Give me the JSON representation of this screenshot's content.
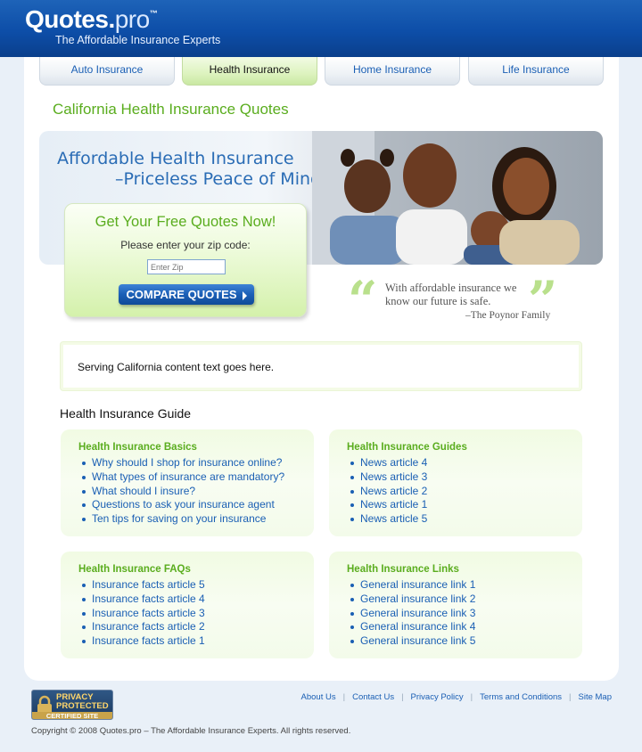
{
  "brand": {
    "name": "Quotes.",
    "suffix": "pro",
    "tm": "™",
    "tagline": "The Affordable Insurance Experts"
  },
  "nav": {
    "tabs": [
      {
        "label": "Auto Insurance"
      },
      {
        "label": "Health Insurance",
        "active": true
      },
      {
        "label": "Home Insurance"
      },
      {
        "label": "Life Insurance"
      }
    ]
  },
  "page_title": "California Health Insurance Quotes",
  "hero": {
    "line1": "Affordable Health Insurance",
    "line2": "–Priceless Peace of Mind."
  },
  "quote_form": {
    "heading": "Get Your Free Quotes Now!",
    "prompt": "Please enter your zip code:",
    "zip_placeholder": "Enter Zip",
    "button_label": "COMPARE QUOTES"
  },
  "testimonial": {
    "line1": "With affordable insurance we",
    "line2": "know our future is safe.",
    "attribution": "–The Poynor Family"
  },
  "serving_text": "Serving California content text goes here.",
  "guide": {
    "title": "Health Insurance Guide",
    "sections": [
      {
        "heading": "Health Insurance Basics",
        "items": [
          "Why should I shop for insurance online?",
          "What types of insurance are mandatory?",
          "What should I insure?",
          "Questions to ask your insurance agent",
          "Ten tips for saving on your insurance"
        ]
      },
      {
        "heading": "Health Insurance Guides",
        "items": [
          "News article 4",
          "News article 3",
          "News article 2",
          "News article 1",
          "News article 5"
        ]
      },
      {
        "heading": "Health Insurance FAQs",
        "items": [
          "Insurance facts article 5",
          "Insurance facts article 4",
          "Insurance facts article 3",
          "Insurance facts article 2",
          "Insurance facts article 1"
        ]
      },
      {
        "heading": "Health Insurance Links",
        "items": [
          "General insurance link 1",
          "General insurance link 2",
          "General insurance link 3",
          "General insurance link 4",
          "General insurance link 5"
        ]
      }
    ]
  },
  "badge": {
    "line1": "PRIVACY",
    "line2": "PROTECTED",
    "line3": "CERTIFIED SITE"
  },
  "footer": {
    "links": [
      "About Us",
      "Contact Us",
      "Privacy Policy",
      "Terms and Conditions",
      "Site Map"
    ],
    "copyright": "Copyright © 2008 Quotes.pro – The Affordable Insurance Experts. All rights reserved."
  },
  "colors": {
    "header_blue": "#0d4ea8",
    "accent_green": "#5aad1e",
    "link_blue": "#1a5fb4"
  }
}
